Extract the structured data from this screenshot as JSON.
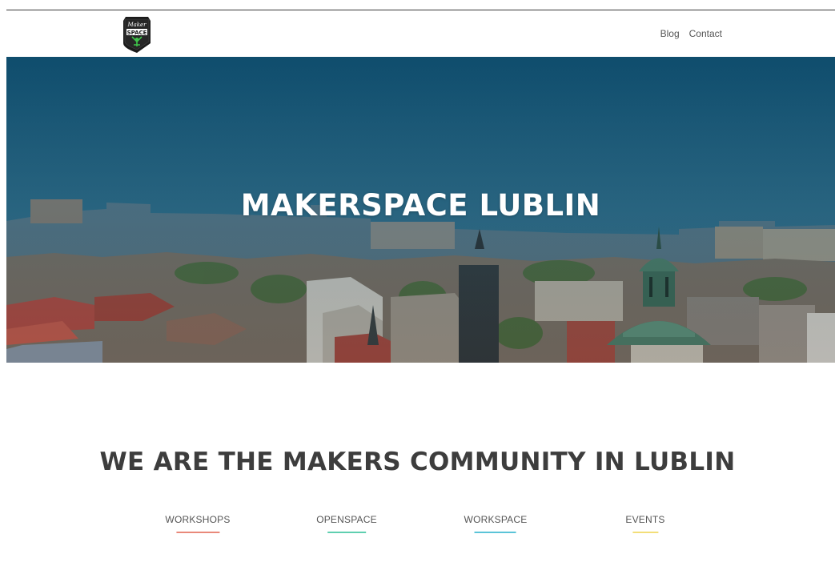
{
  "header": {
    "logo_alt": "Maker Space",
    "nav": [
      {
        "label": "Blog"
      },
      {
        "label": "Contact"
      }
    ]
  },
  "hero": {
    "title": "MAKERSPACE LUBLIN"
  },
  "main": {
    "tagline": "WE ARE THE MAKERS COMMUNITY IN LUBLIN",
    "features": [
      {
        "label": "WORKSHOPS",
        "color": "#e9897a"
      },
      {
        "label": "OPENSPACE",
        "color": "#5fcfb0"
      },
      {
        "label": "WORKSPACE",
        "color": "#5bc4d8"
      },
      {
        "label": "EVENTS",
        "color": "#f3de78"
      }
    ]
  },
  "colors": {
    "hero_tint": "#1c5a78",
    "text_dark": "#3d3d3d"
  }
}
